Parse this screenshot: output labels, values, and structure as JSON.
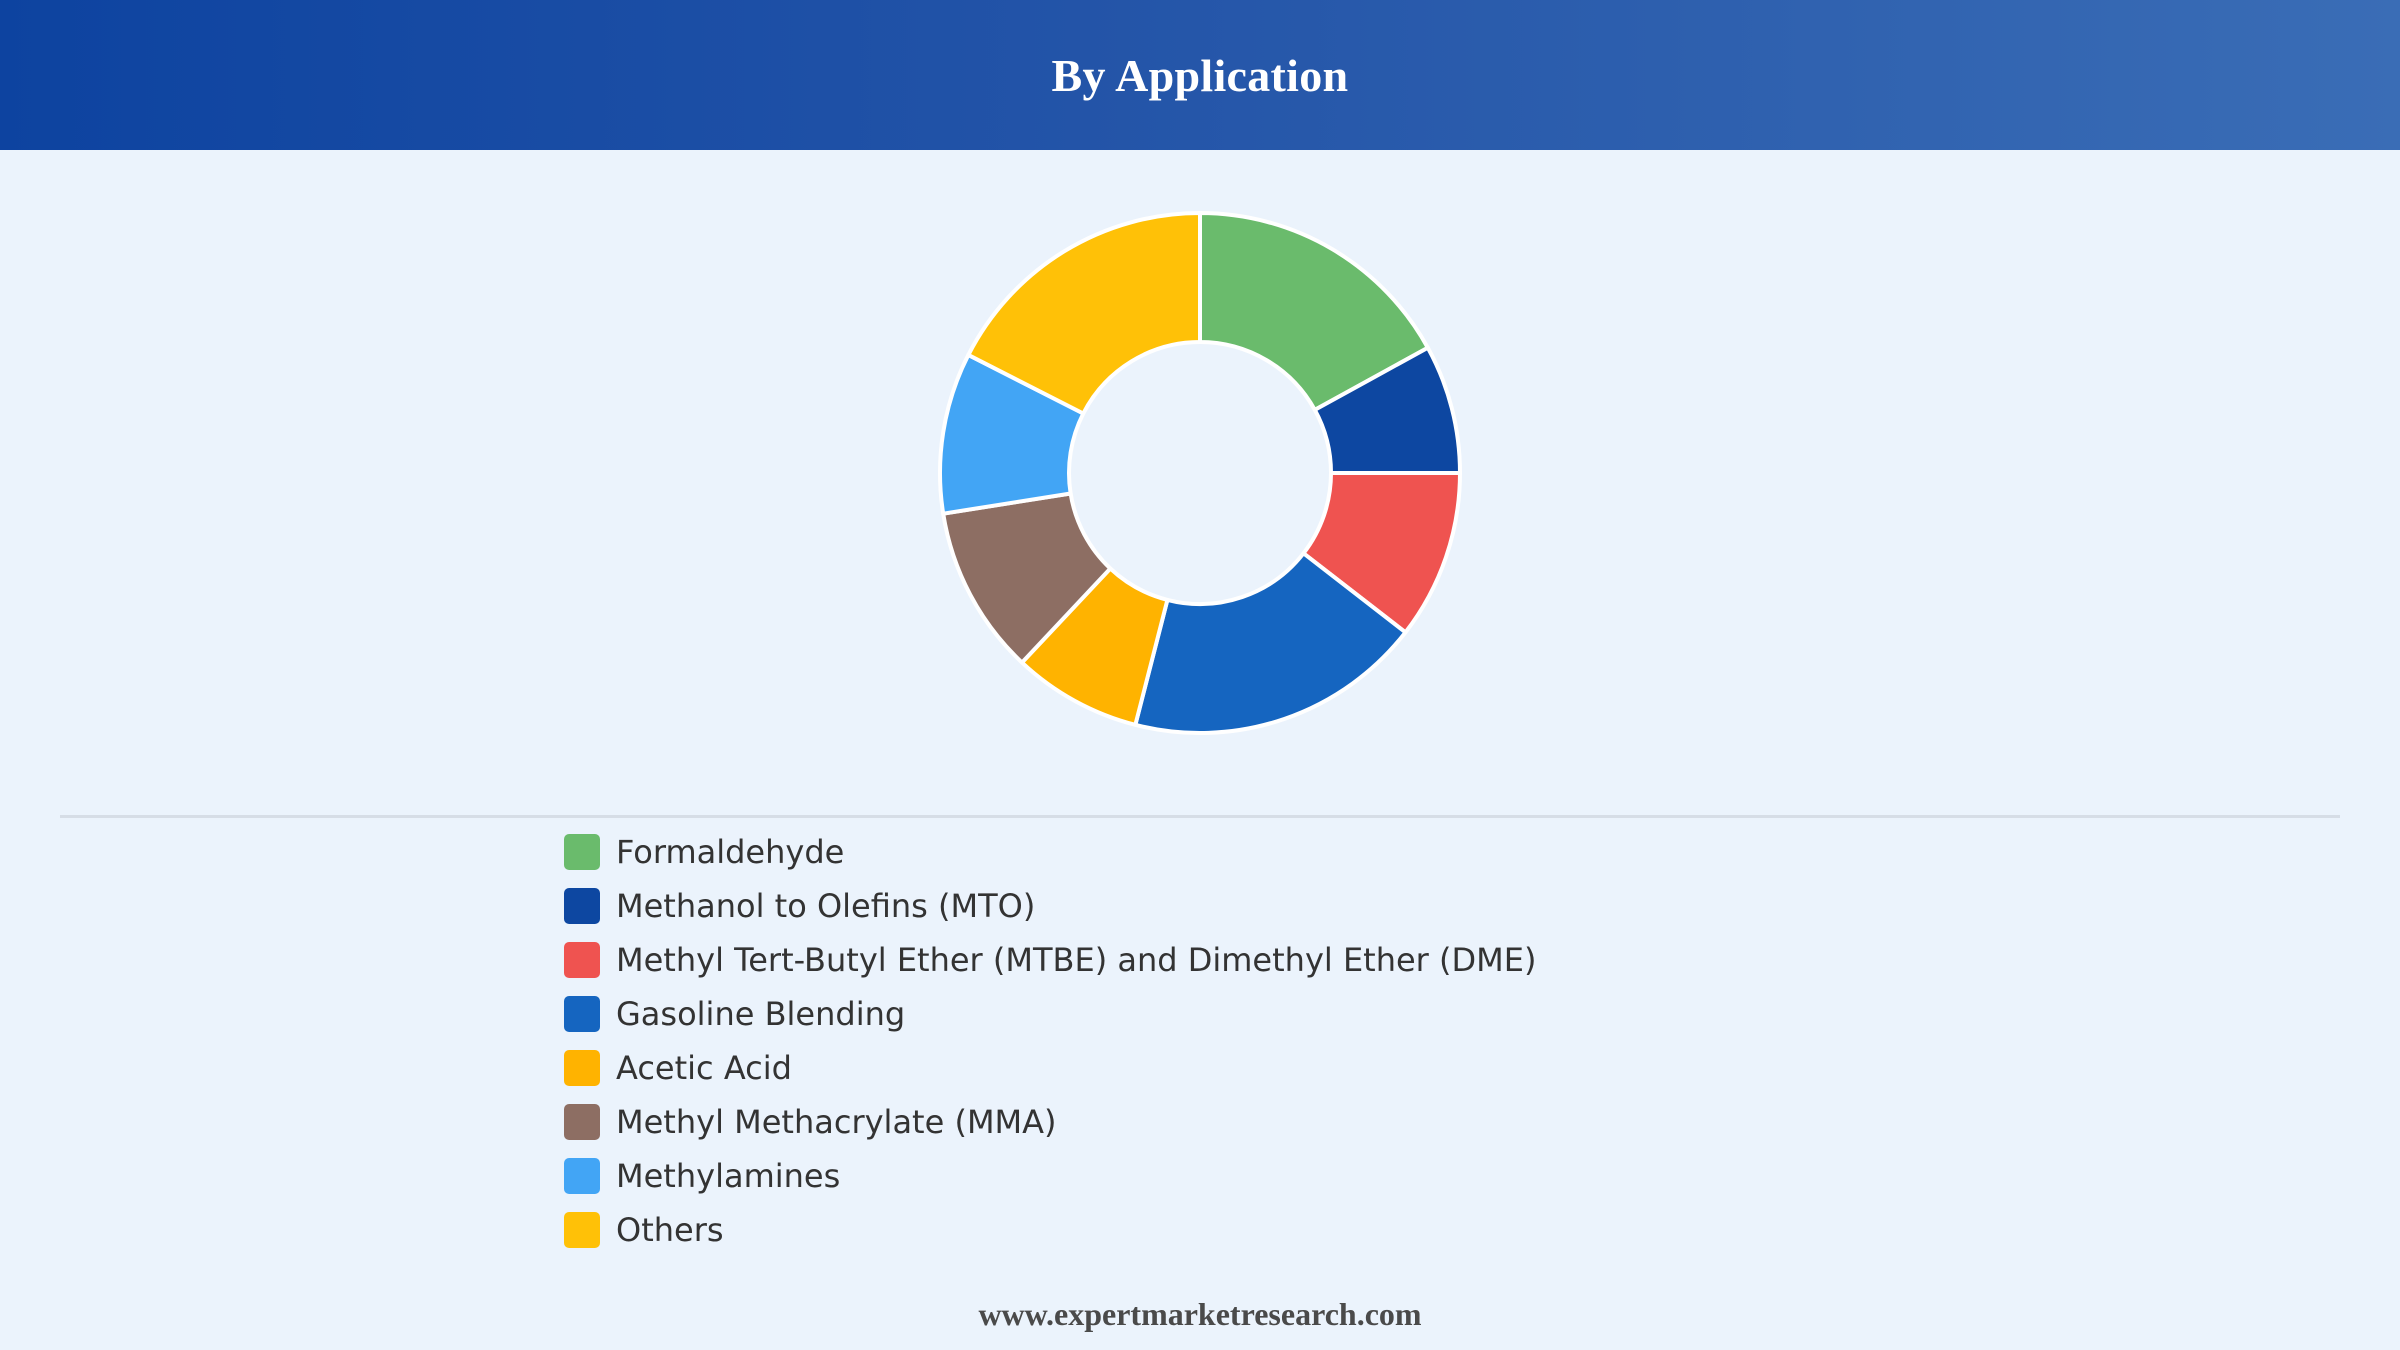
{
  "header": {
    "title": "By Application"
  },
  "chart_data": {
    "type": "pie",
    "title": "By Application",
    "donut": true,
    "legend_position": "bottom-left",
    "categories": [
      "Formaldehyde",
      "Methanol to Olefins (MTO)",
      "Methyl Tert-Butyl Ether (MTBE) and Dimethyl Ether (DME)",
      "Gasoline Blending",
      "Acetic Acid",
      "Methyl Methacrylate (MMA)",
      "Methylamines",
      "Others"
    ],
    "values": [
      17,
      8,
      10.5,
      18.5,
      8,
      10.5,
      10,
      17.5
    ],
    "colors": [
      "#6abb6c",
      "#0d47a1",
      "#ef5350",
      "#1565c0",
      "#ffb300",
      "#8d6e63",
      "#42a5f5",
      "#ffc107"
    ]
  },
  "footer": {
    "text": "www.expertmarketresearch.com"
  }
}
